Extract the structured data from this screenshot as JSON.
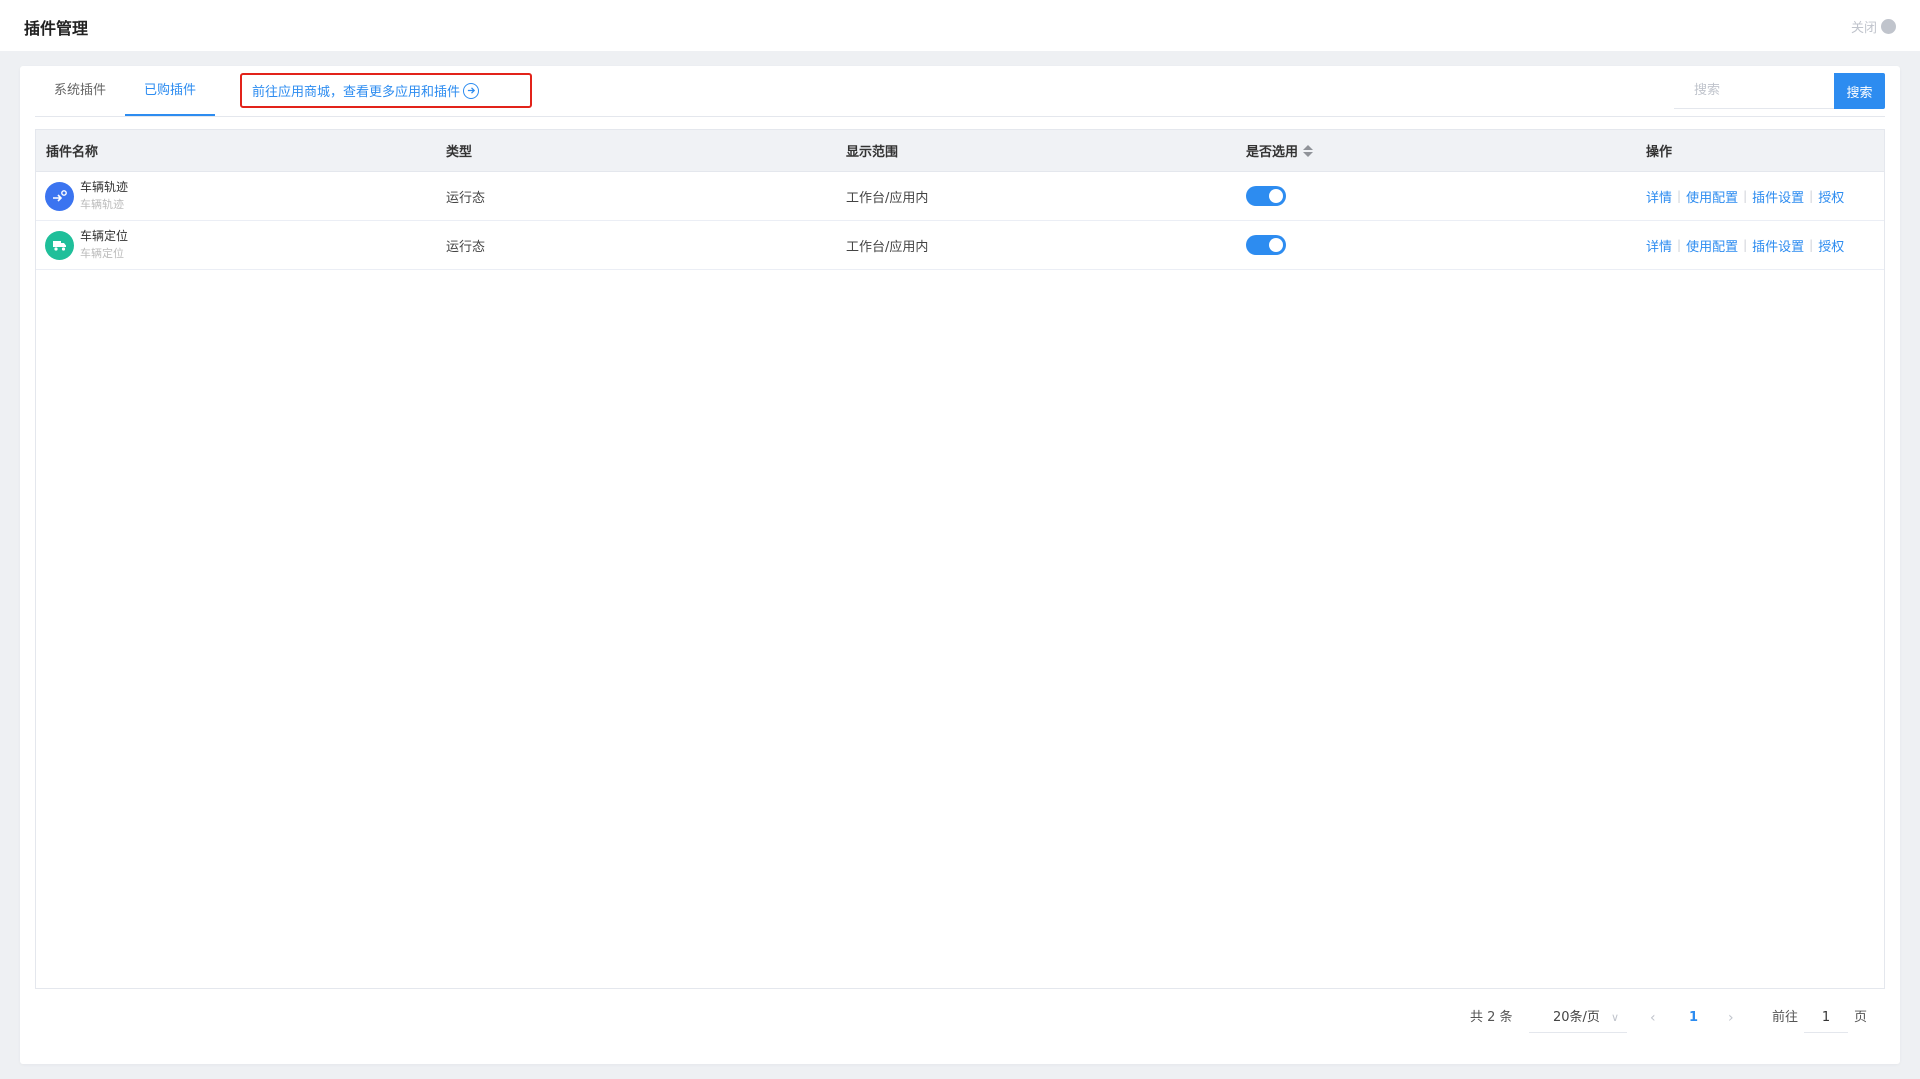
{
  "header": {
    "title": "插件管理",
    "close_label": "关闭"
  },
  "tabs": [
    {
      "label": "系统插件",
      "active": false
    },
    {
      "label": "已购插件",
      "active": true
    }
  ],
  "store_link": {
    "label": "前往应用商城，查看更多应用和插件",
    "icon": "arrow-right-circle-icon"
  },
  "search": {
    "placeholder": "搜索",
    "button_label": "搜索"
  },
  "table": {
    "columns": [
      "插件名称",
      "类型",
      "显示范围",
      "是否选用",
      "操作"
    ],
    "rows": [
      {
        "name": "车辆轨迹",
        "subtitle": "车辆轨迹",
        "icon": "vehicle-track-icon",
        "icon_color": "#3b74f0",
        "type": "运行态",
        "scope": "工作台/应用内",
        "enabled": true
      },
      {
        "name": "车辆定位",
        "subtitle": "车辆定位",
        "icon": "truck-icon",
        "icon_color": "#1fbf9a",
        "type": "运行态",
        "scope": "工作台/应用内",
        "enabled": true
      }
    ],
    "actions": [
      "详情",
      "使用配置",
      "插件设置",
      "授权"
    ]
  },
  "pagination": {
    "total_label": "共 2 条",
    "page_size_label": "20条/页",
    "current_page": "1",
    "goto_prefix": "前往",
    "goto_value": "1",
    "goto_suffix": "页"
  },
  "colors": {
    "accent": "#2d8cf0",
    "highlight_border": "#e2231a"
  }
}
